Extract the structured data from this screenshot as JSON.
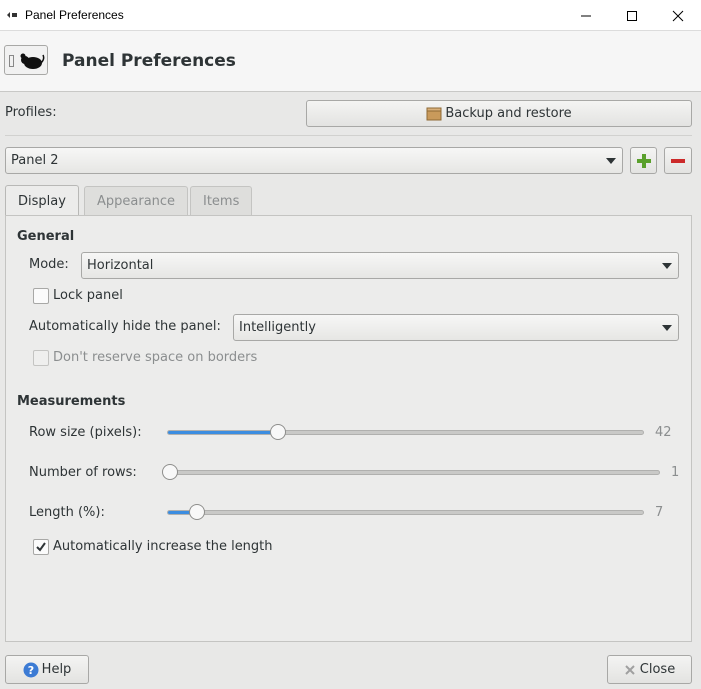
{
  "window": {
    "title": "Panel Preferences"
  },
  "header": {
    "title": "Panel Preferences"
  },
  "profiles": {
    "label": "Profiles:",
    "backup_button": "Backup and restore"
  },
  "panel_selector": {
    "selected": "Panel 2"
  },
  "tabs": [
    {
      "label": "Display",
      "active": true
    },
    {
      "label": "Appearance",
      "active": false
    },
    {
      "label": "Items",
      "active": false
    }
  ],
  "general": {
    "heading": "General",
    "mode_label": "Mode:",
    "mode_value": "Horizontal",
    "lock_panel_label": "Lock panel",
    "lock_panel_checked": false,
    "autohide_label": "Automatically hide the panel:",
    "autohide_value": "Intelligently",
    "reserve_space_label": "Don't reserve space on borders",
    "reserve_space_checked": false
  },
  "measurements": {
    "heading": "Measurements",
    "row_size_label": "Row size (pixels):",
    "row_size_value": "42",
    "rows_label": "Number of rows:",
    "rows_value": "1",
    "length_label": "Length (%):",
    "length_value": "7",
    "auto_length_label": "Automatically increase the length",
    "auto_length_checked": true
  },
  "footer": {
    "help_label": "Help",
    "close_label": "Close"
  },
  "icons": {
    "minimize": "minimize-icon",
    "maximize": "maximize-icon",
    "close": "close-icon",
    "backup": "box-icon",
    "add": "plus-icon",
    "remove": "minus-icon",
    "help": "question-icon",
    "close_btn": "x-icon"
  },
  "colors": {
    "accent": "#3c8de0",
    "add": "#5aa02c",
    "remove": "#cc2a2a"
  }
}
